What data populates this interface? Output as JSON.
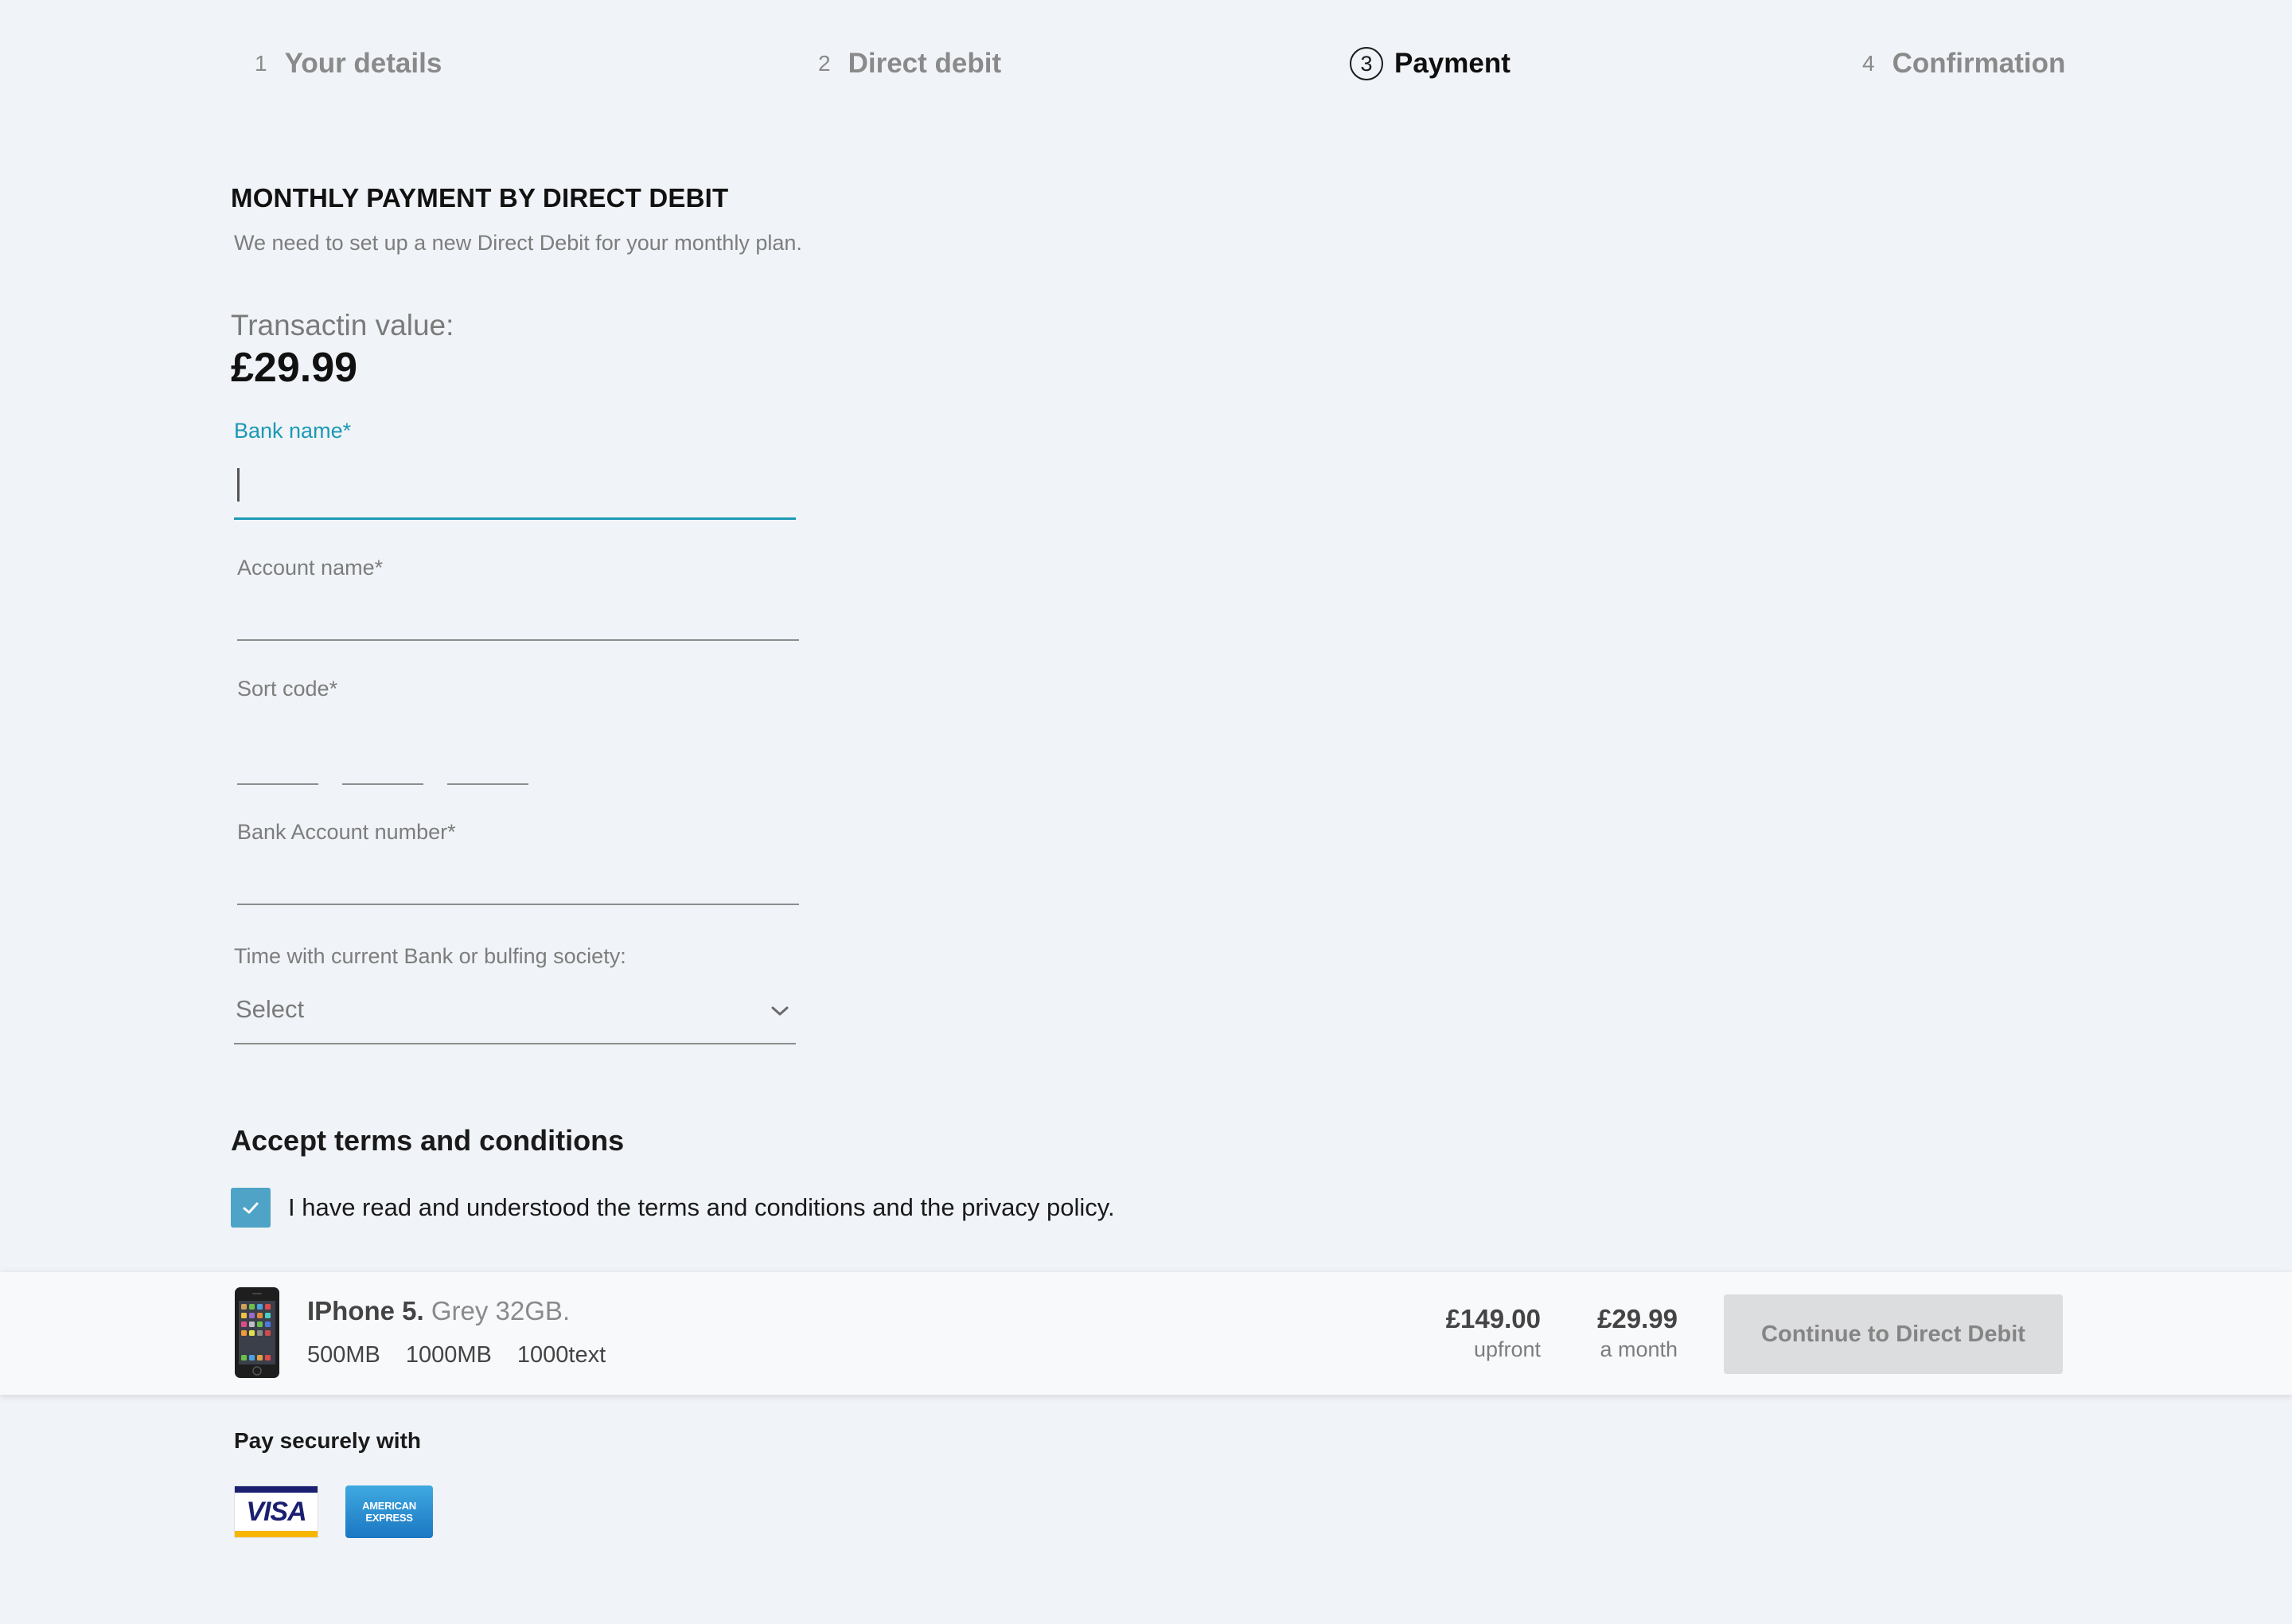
{
  "stepper": {
    "steps": [
      {
        "number": "1",
        "label": "Your details"
      },
      {
        "number": "2",
        "label": "Direct debit"
      },
      {
        "number": "3",
        "label": "Payment"
      },
      {
        "number": "4",
        "label": "Confirmation"
      }
    ],
    "active_step": 3
  },
  "form": {
    "title": "MONTHLY PAYMENT BY DIRECT DEBIT",
    "subtitle": "We need to set up a new Direct Debit for your monthly plan.",
    "transaction_label": "Transactin value:",
    "transaction_value": "£29.99",
    "fields": {
      "bank_name": {
        "label": "Bank name*",
        "value": ""
      },
      "account_name": {
        "label": "Account name*",
        "value": ""
      },
      "sort_code": {
        "label": "Sort code*",
        "values": [
          "",
          "",
          ""
        ]
      },
      "account_number": {
        "label": "Bank Account number*",
        "value": ""
      },
      "time_with_bank": {
        "label": "Time with current Bank or bulfing society:",
        "selected": "Select"
      }
    }
  },
  "terms": {
    "title": "Accept terms and conditions",
    "checkbox_label": "I have read and understood the terms and conditions and the privacy policy.",
    "checked": true
  },
  "summary": {
    "product_model": "IPhone 5.",
    "product_variant": "Grey 32GB.",
    "allowances": [
      "500MB",
      "1000MB",
      "1000text"
    ],
    "upfront_price": "£149.00",
    "upfront_label": "upfront",
    "monthly_price": "£29.99",
    "monthly_label": "a month",
    "continue_label": "Continue to Direct Debit"
  },
  "payment": {
    "title": "Pay securely with",
    "cards": [
      {
        "icon": "visa-logo",
        "text": "VISA"
      },
      {
        "icon": "amex-logo",
        "text": "AMERICAN EXPRESS"
      }
    ]
  },
  "colors": {
    "background": "#f0f3f7",
    "accent": "#1b99b5",
    "checkbox": "#4fa3c7",
    "button_disabled": "#dcdddf"
  }
}
